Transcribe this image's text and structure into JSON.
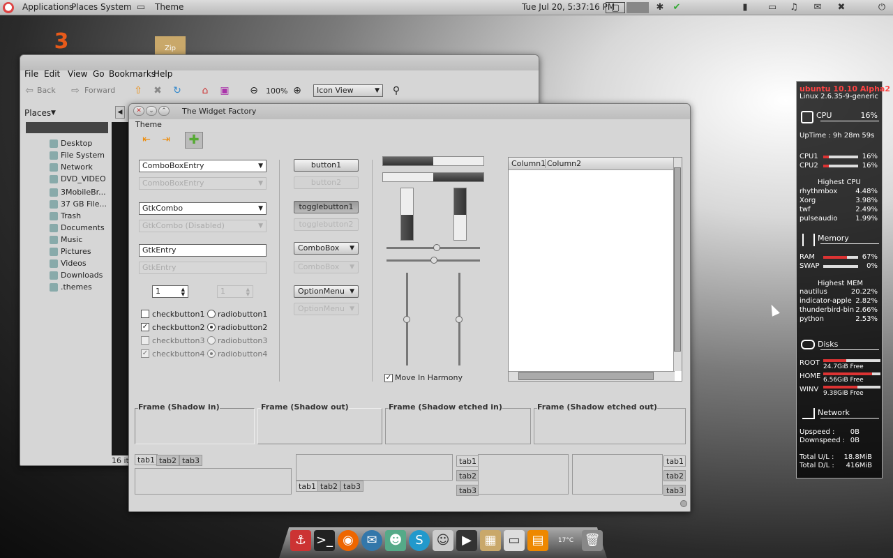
{
  "panel": {
    "applications": "Applications",
    "places": "Places",
    "system": "System",
    "theme": "Theme",
    "datetime": "Tue Jul 20,  5:37:16 PM"
  },
  "desktop": {
    "icon1": "3",
    "icon2": "Zip"
  },
  "nautilus": {
    "menu": [
      "File",
      "Edit",
      "View",
      "Go",
      "Bookmarks",
      "Help"
    ],
    "back": "Back",
    "forward": "Forward",
    "zoom": "100%",
    "view_mode": "Icon View",
    "places_header": "Places",
    "places": [
      "Desktop",
      "File System",
      "Network",
      "DVD_VIDEO",
      "3MobileBr...",
      "37 GB File...",
      "Trash",
      "Documents",
      "Music",
      "Pictures",
      "Videos",
      "Downloads",
      ".themes"
    ],
    "status": "16 it"
  },
  "widget_factory": {
    "title": "The Widget Factory",
    "menu": "Theme",
    "combo_entry": "ComboBoxEntry",
    "combo_entry_dis": "ComboBoxEntry",
    "gtk_combo": "GtkCombo",
    "gtk_combo_dis": "GtkCombo (Disabled)",
    "gtk_entry": "GtkEntry",
    "gtk_entry_dis": "GtkEntry",
    "spin": "1",
    "spin_dis": "1",
    "checks": [
      "checkbutton1",
      "checkbutton2",
      "checkbutton3",
      "checkbutton4"
    ],
    "radios": [
      "radiobutton1",
      "radiobutton2",
      "radiobutton3",
      "radiobutton4"
    ],
    "button1": "button1",
    "button2": "button2",
    "toggle1": "togglebutton1",
    "toggle2": "togglebutton2",
    "combobox": "ComboBox",
    "combobox_dis": "ComboBox",
    "optionmenu": "OptionMenu",
    "optionmenu_dis": "OptionMenu",
    "harmony": "Move In Harmony",
    "col1": "Column1",
    "col2": "Column2",
    "frames": [
      "Frame (Shadow in)",
      "Frame (Shadow out)",
      "Frame (Shadow etched in)",
      "Frame (Shadow etched out)"
    ],
    "tabs": [
      "tab1",
      "tab2",
      "tab3"
    ]
  },
  "conky": {
    "os": "ubuntu 10.10 Alpha2",
    "kernel": "Linux 2.6.35-9-generic",
    "cpu_label": "CPU",
    "cpu_total": "16%",
    "uptime": "UpTime :  9h 28m 59s",
    "cpu1": "CPU1",
    "cpu1_v": "16%",
    "cpu1_pct": 0.16,
    "cpu2": "CPU2",
    "cpu2_v": "16%",
    "cpu2_pct": 0.16,
    "highest_cpu": "Highest CPU",
    "cpu_procs": [
      [
        "rhythmbox",
        "4.48%"
      ],
      [
        "Xorg",
        "3.98%"
      ],
      [
        "twf",
        "2.49%"
      ],
      [
        "pulseaudio",
        "1.99%"
      ]
    ],
    "memory": "Memory",
    "ram": "RAM",
    "ram_v": "67%",
    "ram_pct": 0.67,
    "swap": "SWAP",
    "swap_v": "0%",
    "swap_pct": 0,
    "highest_mem": "Highest MEM",
    "mem_procs": [
      [
        "nautilus",
        "20.22%"
      ],
      [
        "indicator-apple",
        "2.82%"
      ],
      [
        "thunderbird-bin",
        "2.66%"
      ],
      [
        "python",
        "2.53%"
      ]
    ],
    "disks": "Disks",
    "disk_list": [
      [
        "ROOT",
        "24.7GiB Free",
        0.4
      ],
      [
        "HOME",
        "6.56GiB Free",
        0.85
      ],
      [
        "WINV",
        "9.38GiB Free",
        0.6
      ]
    ],
    "network": "Network",
    "up": "Upspeed :",
    "up_v": "0B",
    "down": "Downspeed :",
    "down_v": "0B",
    "total_ul": "Total U/L :",
    "total_ul_v": "18.8MiB",
    "total_dl": "Total D/L :",
    "total_dl_v": "416MiB"
  },
  "dock": {
    "temp": "17°C"
  }
}
